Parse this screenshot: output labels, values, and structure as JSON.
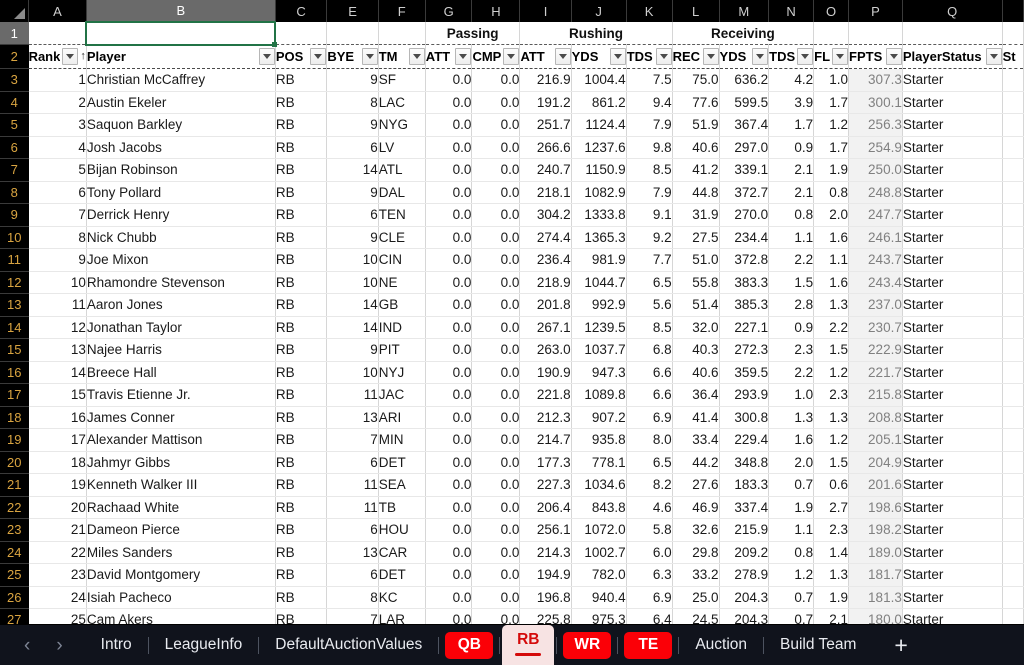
{
  "app": {
    "theme_accent": "#fb0007",
    "selected_cell": "B1",
    "selected_column": "B",
    "selected_row": "1"
  },
  "grid": {
    "column_letters": [
      "A",
      "B",
      "C",
      "E",
      "F",
      "G",
      "H",
      "I",
      "J",
      "K",
      "L",
      "M",
      "N",
      "O",
      "P",
      "Q"
    ],
    "row_numbers": [
      "1",
      "2",
      "3",
      "4",
      "5",
      "6",
      "7",
      "8",
      "9",
      "10",
      "11",
      "12",
      "13",
      "14",
      "15",
      "16",
      "17",
      "18",
      "19",
      "20",
      "21",
      "22",
      "23",
      "24",
      "25",
      "26",
      "27"
    ],
    "group_headers": [
      {
        "label": "Passing",
        "span": 2
      },
      {
        "label": "Rushing",
        "span": 3
      },
      {
        "label": "Receiving",
        "span": 3
      }
    ],
    "headers": [
      {
        "key": "rank",
        "label": "Rank",
        "sorted": "asc"
      },
      {
        "key": "player",
        "label": "Player"
      },
      {
        "key": "pos",
        "label": "POS"
      },
      {
        "key": "bye",
        "label": "BYE"
      },
      {
        "key": "tm",
        "label": "TM"
      },
      {
        "key": "patt",
        "label": "ATT"
      },
      {
        "key": "pcmp",
        "label": "CMP"
      },
      {
        "key": "ratt",
        "label": "ATT"
      },
      {
        "key": "ryds",
        "label": "YDS"
      },
      {
        "key": "rtds",
        "label": "TDS"
      },
      {
        "key": "rec",
        "label": "REC"
      },
      {
        "key": "recyds",
        "label": "YDS"
      },
      {
        "key": "rectds",
        "label": "TDS"
      },
      {
        "key": "fl",
        "label": "FL"
      },
      {
        "key": "fpts",
        "label": "FPTS"
      },
      {
        "key": "status",
        "label": "PlayerStatus"
      },
      {
        "key": "extra",
        "label": "St"
      }
    ],
    "rows": [
      {
        "r": "3",
        "rank": "1",
        "player": "Christian McCaffrey",
        "pos": "RB",
        "bye": "9",
        "tm": "SF",
        "patt": "0.0",
        "pcmp": "0.0",
        "ratt": "216.9",
        "ryds": "1004.4",
        "rtds": "7.5",
        "rec": "75.0",
        "recyds": "636.2",
        "rectds": "4.2",
        "fl": "1.0",
        "fpts": "307.3",
        "status": "Starter"
      },
      {
        "r": "4",
        "rank": "2",
        "player": "Austin Ekeler",
        "pos": "RB",
        "bye": "8",
        "tm": "LAC",
        "patt": "0.0",
        "pcmp": "0.0",
        "ratt": "191.2",
        "ryds": "861.2",
        "rtds": "9.4",
        "rec": "77.6",
        "recyds": "599.5",
        "rectds": "3.9",
        "fl": "1.7",
        "fpts": "300.1",
        "status": "Starter"
      },
      {
        "r": "5",
        "rank": "3",
        "player": "Saquon Barkley",
        "pos": "RB",
        "bye": "9",
        "tm": "NYG",
        "patt": "0.0",
        "pcmp": "0.0",
        "ratt": "251.7",
        "ryds": "1124.4",
        "rtds": "7.9",
        "rec": "51.9",
        "recyds": "367.4",
        "rectds": "1.7",
        "fl": "1.2",
        "fpts": "256.3",
        "status": "Starter"
      },
      {
        "r": "6",
        "rank": "4",
        "player": "Josh Jacobs",
        "pos": "RB",
        "bye": "6",
        "tm": "LV",
        "patt": "0.0",
        "pcmp": "0.0",
        "ratt": "266.6",
        "ryds": "1237.6",
        "rtds": "9.8",
        "rec": "40.6",
        "recyds": "297.0",
        "rectds": "0.9",
        "fl": "1.7",
        "fpts": "254.9",
        "status": "Starter"
      },
      {
        "r": "7",
        "rank": "5",
        "player": "Bijan Robinson",
        "pos": "RB",
        "bye": "14",
        "tm": "ATL",
        "patt": "0.0",
        "pcmp": "0.0",
        "ratt": "240.7",
        "ryds": "1150.9",
        "rtds": "8.5",
        "rec": "41.2",
        "recyds": "339.1",
        "rectds": "2.1",
        "fl": "1.9",
        "fpts": "250.0",
        "status": "Starter"
      },
      {
        "r": "8",
        "rank": "6",
        "player": "Tony Pollard",
        "pos": "RB",
        "bye": "9",
        "tm": "DAL",
        "patt": "0.0",
        "pcmp": "0.0",
        "ratt": "218.1",
        "ryds": "1082.9",
        "rtds": "7.9",
        "rec": "44.8",
        "recyds": "372.7",
        "rectds": "2.1",
        "fl": "0.8",
        "fpts": "248.8",
        "status": "Starter"
      },
      {
        "r": "9",
        "rank": "7",
        "player": "Derrick Henry",
        "pos": "RB",
        "bye": "6",
        "tm": "TEN",
        "patt": "0.0",
        "pcmp": "0.0",
        "ratt": "304.2",
        "ryds": "1333.8",
        "rtds": "9.1",
        "rec": "31.9",
        "recyds": "270.0",
        "rectds": "0.8",
        "fl": "2.0",
        "fpts": "247.7",
        "status": "Starter"
      },
      {
        "r": "10",
        "rank": "8",
        "player": "Nick Chubb",
        "pos": "RB",
        "bye": "9",
        "tm": "CLE",
        "patt": "0.0",
        "pcmp": "0.0",
        "ratt": "274.4",
        "ryds": "1365.3",
        "rtds": "9.2",
        "rec": "27.5",
        "recyds": "234.4",
        "rectds": "1.1",
        "fl": "1.6",
        "fpts": "246.1",
        "status": "Starter"
      },
      {
        "r": "11",
        "rank": "9",
        "player": "Joe Mixon",
        "pos": "RB",
        "bye": "10",
        "tm": "CIN",
        "patt": "0.0",
        "pcmp": "0.0",
        "ratt": "236.4",
        "ryds": "981.9",
        "rtds": "7.7",
        "rec": "51.0",
        "recyds": "372.8",
        "rectds": "2.2",
        "fl": "1.1",
        "fpts": "243.7",
        "status": "Starter"
      },
      {
        "r": "12",
        "rank": "10",
        "player": "Rhamondre Stevenson",
        "pos": "RB",
        "bye": "10",
        "tm": "NE",
        "patt": "0.0",
        "pcmp": "0.0",
        "ratt": "218.9",
        "ryds": "1044.7",
        "rtds": "6.5",
        "rec": "55.8",
        "recyds": "383.3",
        "rectds": "1.5",
        "fl": "1.6",
        "fpts": "243.4",
        "status": "Starter"
      },
      {
        "r": "13",
        "rank": "11",
        "player": "Aaron Jones",
        "pos": "RB",
        "bye": "14",
        "tm": "GB",
        "patt": "0.0",
        "pcmp": "0.0",
        "ratt": "201.8",
        "ryds": "992.9",
        "rtds": "5.6",
        "rec": "51.4",
        "recyds": "385.3",
        "rectds": "2.8",
        "fl": "1.3",
        "fpts": "237.0",
        "status": "Starter"
      },
      {
        "r": "14",
        "rank": "12",
        "player": "Jonathan Taylor",
        "pos": "RB",
        "bye": "14",
        "tm": "IND",
        "patt": "0.0",
        "pcmp": "0.0",
        "ratt": "267.1",
        "ryds": "1239.5",
        "rtds": "8.5",
        "rec": "32.0",
        "recyds": "227.1",
        "rectds": "0.9",
        "fl": "2.2",
        "fpts": "230.7",
        "status": "Starter"
      },
      {
        "r": "15",
        "rank": "13",
        "player": "Najee Harris",
        "pos": "RB",
        "bye": "9",
        "tm": "PIT",
        "patt": "0.0",
        "pcmp": "0.0",
        "ratt": "263.0",
        "ryds": "1037.7",
        "rtds": "6.8",
        "rec": "40.3",
        "recyds": "272.3",
        "rectds": "2.3",
        "fl": "1.5",
        "fpts": "222.9",
        "status": "Starter"
      },
      {
        "r": "16",
        "rank": "14",
        "player": "Breece Hall",
        "pos": "RB",
        "bye": "10",
        "tm": "NYJ",
        "patt": "0.0",
        "pcmp": "0.0",
        "ratt": "190.9",
        "ryds": "947.3",
        "rtds": "6.6",
        "rec": "40.6",
        "recyds": "359.5",
        "rectds": "2.2",
        "fl": "1.2",
        "fpts": "221.7",
        "status": "Starter"
      },
      {
        "r": "17",
        "rank": "15",
        "player": "Travis Etienne Jr.",
        "pos": "RB",
        "bye": "11",
        "tm": "JAC",
        "patt": "0.0",
        "pcmp": "0.0",
        "ratt": "221.8",
        "ryds": "1089.8",
        "rtds": "6.6",
        "rec": "36.4",
        "recyds": "293.9",
        "rectds": "1.0",
        "fl": "2.3",
        "fpts": "215.8",
        "status": "Starter"
      },
      {
        "r": "18",
        "rank": "16",
        "player": "James Conner",
        "pos": "RB",
        "bye": "13",
        "tm": "ARI",
        "patt": "0.0",
        "pcmp": "0.0",
        "ratt": "212.3",
        "ryds": "907.2",
        "rtds": "6.9",
        "rec": "41.4",
        "recyds": "300.8",
        "rectds": "1.3",
        "fl": "1.3",
        "fpts": "208.8",
        "status": "Starter"
      },
      {
        "r": "19",
        "rank": "17",
        "player": "Alexander Mattison",
        "pos": "RB",
        "bye": "7",
        "tm": "MIN",
        "patt": "0.0",
        "pcmp": "0.0",
        "ratt": "214.7",
        "ryds": "935.8",
        "rtds": "8.0",
        "rec": "33.4",
        "recyds": "229.4",
        "rectds": "1.6",
        "fl": "1.2",
        "fpts": "205.1",
        "status": "Starter"
      },
      {
        "r": "20",
        "rank": "18",
        "player": "Jahmyr Gibbs",
        "pos": "RB",
        "bye": "6",
        "tm": "DET",
        "patt": "0.0",
        "pcmp": "0.0",
        "ratt": "177.3",
        "ryds": "778.1",
        "rtds": "6.5",
        "rec": "44.2",
        "recyds": "348.8",
        "rectds": "2.0",
        "fl": "1.5",
        "fpts": "204.9",
        "status": "Starter"
      },
      {
        "r": "21",
        "rank": "19",
        "player": "Kenneth Walker III",
        "pos": "RB",
        "bye": "11",
        "tm": "SEA",
        "patt": "0.0",
        "pcmp": "0.0",
        "ratt": "227.3",
        "ryds": "1034.6",
        "rtds": "8.2",
        "rec": "27.6",
        "recyds": "183.3",
        "rectds": "0.7",
        "fl": "0.6",
        "fpts": "201.6",
        "status": "Starter"
      },
      {
        "r": "22",
        "rank": "20",
        "player": "Rachaad White",
        "pos": "RB",
        "bye": "11",
        "tm": "TB",
        "patt": "0.0",
        "pcmp": "0.0",
        "ratt": "206.4",
        "ryds": "843.8",
        "rtds": "4.6",
        "rec": "46.9",
        "recyds": "337.4",
        "rectds": "1.9",
        "fl": "2.7",
        "fpts": "198.6",
        "status": "Starter"
      },
      {
        "r": "23",
        "rank": "21",
        "player": "Dameon Pierce",
        "pos": "RB",
        "bye": "6",
        "tm": "HOU",
        "patt": "0.0",
        "pcmp": "0.0",
        "ratt": "256.1",
        "ryds": "1072.0",
        "rtds": "5.8",
        "rec": "32.6",
        "recyds": "215.9",
        "rectds": "1.1",
        "fl": "2.3",
        "fpts": "198.2",
        "status": "Starter"
      },
      {
        "r": "24",
        "rank": "22",
        "player": "Miles Sanders",
        "pos": "RB",
        "bye": "13",
        "tm": "CAR",
        "patt": "0.0",
        "pcmp": "0.0",
        "ratt": "214.3",
        "ryds": "1002.7",
        "rtds": "6.0",
        "rec": "29.8",
        "recyds": "209.2",
        "rectds": "0.8",
        "fl": "1.4",
        "fpts": "189.0",
        "status": "Starter"
      },
      {
        "r": "25",
        "rank": "23",
        "player": "David Montgomery",
        "pos": "RB",
        "bye": "6",
        "tm": "DET",
        "patt": "0.0",
        "pcmp": "0.0",
        "ratt": "194.9",
        "ryds": "782.0",
        "rtds": "6.3",
        "rec": "33.2",
        "recyds": "278.9",
        "rectds": "1.2",
        "fl": "1.3",
        "fpts": "181.7",
        "status": "Starter"
      },
      {
        "r": "26",
        "rank": "24",
        "player": "Isiah Pacheco",
        "pos": "RB",
        "bye": "8",
        "tm": "KC",
        "patt": "0.0",
        "pcmp": "0.0",
        "ratt": "196.8",
        "ryds": "940.4",
        "rtds": "6.9",
        "rec": "25.0",
        "recyds": "204.3",
        "rectds": "0.7",
        "fl": "1.9",
        "fpts": "181.3",
        "status": "Starter"
      },
      {
        "r": "27",
        "rank": "25",
        "player": "Cam Akers",
        "pos": "RB",
        "bye": "7",
        "tm": "LAR",
        "patt": "0.0",
        "pcmp": "0.0",
        "ratt": "225.8",
        "ryds": "975.3",
        "rtds": "6.4",
        "rec": "24.5",
        "recyds": "204.3",
        "rectds": "0.7",
        "fl": "2.1",
        "fpts": "180.0",
        "status": "Starter"
      }
    ]
  },
  "tabbar": {
    "prev_icon": "‹",
    "next_icon": "›",
    "add_icon": "+",
    "tabs": [
      {
        "label": "Intro",
        "type": "normal",
        "active": false
      },
      {
        "label": "LeagueInfo",
        "type": "normal",
        "active": false
      },
      {
        "label": "DefaultAuctionValues",
        "type": "normal",
        "active": false
      },
      {
        "label": "QB",
        "type": "position",
        "active": false
      },
      {
        "label": "RB",
        "type": "position",
        "active": true
      },
      {
        "label": "WR",
        "type": "position",
        "active": false
      },
      {
        "label": "TE",
        "type": "position",
        "active": false
      },
      {
        "label": "Auction",
        "type": "normal",
        "active": false
      },
      {
        "label": "Build Team",
        "type": "normal",
        "active": false
      }
    ]
  }
}
